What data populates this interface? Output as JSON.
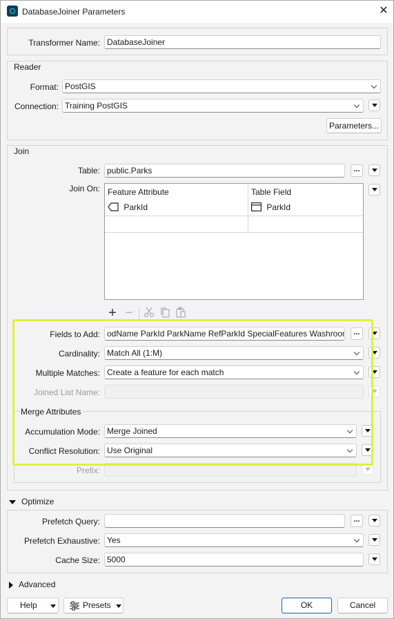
{
  "window": {
    "title": "DatabaseJoiner Parameters",
    "close_glyph": "✕"
  },
  "transformer": {
    "label": "Transformer Name:",
    "value": "DatabaseJoiner"
  },
  "reader": {
    "group_label": "Reader",
    "format_label": "Format:",
    "format_value": "PostGIS",
    "connection_label": "Connection:",
    "connection_value": "Training PostGIS",
    "parameters_button": "Parameters..."
  },
  "join": {
    "group_label": "Join",
    "table_label": "Table:",
    "table_value": "public.Parks",
    "join_on_label": "Join On:",
    "columns": [
      "Feature Attribute",
      "Table Field"
    ],
    "rows": [
      {
        "feature_attribute": "ParkId",
        "table_field": "ParkId"
      }
    ],
    "fields_to_add_label": "Fields to Add:",
    "fields_to_add_value": "odName ParkId ParkName RefParkId SpecialFeatures Washrooms",
    "cardinality_label": "Cardinality:",
    "cardinality_value": "Match All (1:M)",
    "multiple_matches_label": "Multiple Matches:",
    "multiple_matches_value": "Create a feature for each match",
    "joined_list_name_label": "Joined List Name:",
    "joined_list_name_value": "",
    "merge_group_label": "Merge Attributes",
    "accumulation_mode_label": "Accumulation Mode:",
    "accumulation_mode_value": "Merge Joined",
    "conflict_resolution_label": "Conflict Resolution:",
    "conflict_resolution_value": "Use Original",
    "prefix_label": "Prefix:",
    "prefix_value": ""
  },
  "optimize": {
    "header": "Optimize",
    "prefetch_query_label": "Prefetch Query:",
    "prefetch_query_value": "",
    "prefetch_exhaustive_label": "Prefetch Exhaustive:",
    "prefetch_exhaustive_value": "Yes",
    "cache_size_label": "Cache Size:",
    "cache_size_value": "5000"
  },
  "advanced": {
    "header": "Advanced"
  },
  "footer": {
    "help": "Help",
    "presets": "Presets",
    "ok": "OK",
    "cancel": "Cancel"
  },
  "icons": {
    "ellipsis": "...",
    "add": "+",
    "remove": "−"
  },
  "colors": {
    "highlight": "#dff03a",
    "ok_border": "#1a5fb4"
  }
}
